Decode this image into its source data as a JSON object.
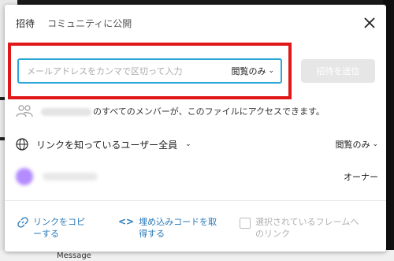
{
  "tabs": [
    "招待",
    "コミュニティに公開"
  ],
  "invite": {
    "placeholder": "メールアドレスをカンマで区切って入力",
    "permission": "閲覧のみ",
    "send_label": "招待を送信"
  },
  "members_text": "のすべてのメンバーが、このファイルにアクセスできます。",
  "link_access": {
    "label": "リンクを知っているユーザー全員",
    "permission": "閲覧のみ"
  },
  "owner": {
    "role": "オーナー"
  },
  "footer": {
    "copy_link": [
      "リンクをコピ",
      "ーする"
    ],
    "embed": [
      "埋め込みコードを取",
      "得する"
    ],
    "frame_link": [
      "選択されているフレームへ",
      "のリンク"
    ]
  },
  "background": {
    "bottom_text": "Message"
  },
  "colors": {
    "highlight": "#e0181a",
    "input_border": "#2aa7d6",
    "link": "#2a7ab8",
    "avatar": "#b48cff"
  }
}
